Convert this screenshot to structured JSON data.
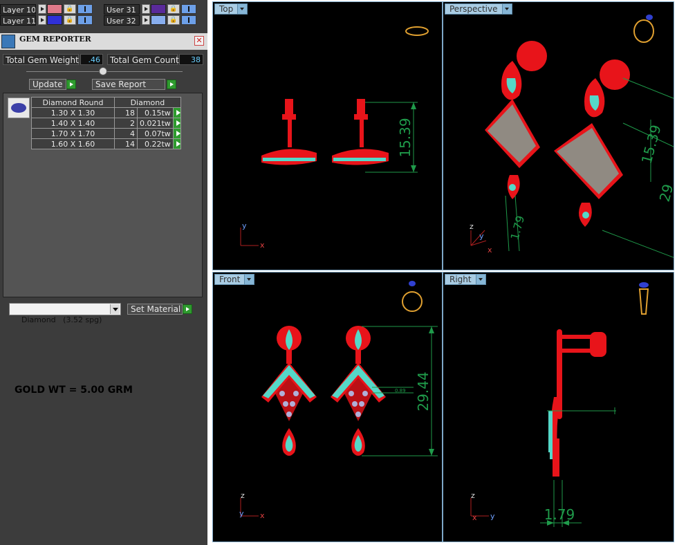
{
  "layers": [
    {
      "name": "Layer 10",
      "color": "#e07a8a"
    },
    {
      "name": "Layer 11",
      "color": "#3030d8"
    },
    {
      "name": "User 31",
      "color": "#5a2a9a"
    },
    {
      "name": "User 32",
      "color": "#88aeee"
    }
  ],
  "gem_reporter": {
    "title": "GEM REPORTER",
    "total_weight_label": "Total Gem Weight",
    "total_weight_value": ".46",
    "total_count_label": "Total Gem Count",
    "total_count_value": "38",
    "update_label": "Update",
    "save_report_label": "Save Report",
    "table_header": {
      "shape": "Diamond Round",
      "material": "Diamond"
    },
    "rows": [
      {
        "size": "1.30 X 1.30",
        "count": "18",
        "weight": "0.15tw"
      },
      {
        "size": "1.40 X 1.40",
        "count": "2",
        "weight": "0.021tw"
      },
      {
        "size": "1.70 X 1.70",
        "count": "4",
        "weight": "0.07tw"
      },
      {
        "size": "1.60 X 1.60",
        "count": "14",
        "weight": "0.22tw"
      }
    ],
    "material_select": "Diamond   (3.52 spg)",
    "set_material_label": "Set Material"
  },
  "gold_weight_note": "GOLD WT = 5.00 GRM",
  "viewports": {
    "top": {
      "label": "Top",
      "dimension": "15.39"
    },
    "perspective": {
      "label": "Perspective",
      "dimension_a": "15.39",
      "dimension_b": "1.79",
      "dimension_c": "29"
    },
    "front": {
      "label": "Front",
      "dimension": "29.44",
      "dimension_small": "0.89"
    },
    "right": {
      "label": "Right",
      "dimension": "1.79"
    }
  },
  "axes": {
    "x": "x",
    "y": "y",
    "z": "z"
  },
  "colors": {
    "metal": "#e8141a",
    "gem_cyan": "#55d8c8",
    "dimension": "#1f9a4a",
    "viewport_bg": "#000000",
    "tab_bg": "#a9cce3"
  }
}
